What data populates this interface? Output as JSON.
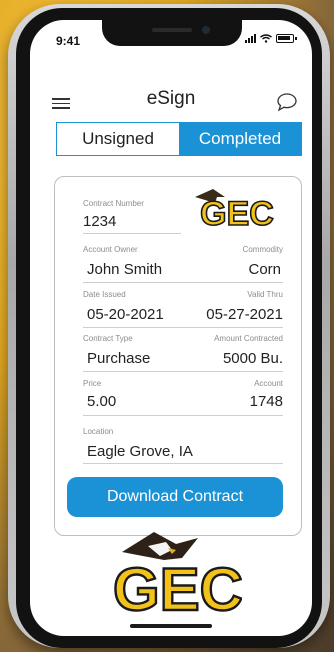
{
  "status_bar": {
    "time": "9:41"
  },
  "header": {
    "title": "eSign"
  },
  "tabs": [
    {
      "label": "Unsigned",
      "active": false
    },
    {
      "label": "Completed",
      "active": true
    }
  ],
  "contract": {
    "contract_number": {
      "label": "Contract Number",
      "value": "1234"
    },
    "account_owner": {
      "label": "Account Owner",
      "value": "John Smith"
    },
    "commodity": {
      "label": "Commodity",
      "value": "Corn"
    },
    "date_issued": {
      "label": "Date Issued",
      "value": "05-20-2021"
    },
    "valid_thru": {
      "label": "Valid Thru",
      "value": "05-27-2021"
    },
    "contract_type": {
      "label": "Contract Type",
      "value": "Purchase"
    },
    "amount_contracted": {
      "label": "Amount Contracted",
      "value": "5000 Bu."
    },
    "price": {
      "label": "Price",
      "value": "5.00"
    },
    "account": {
      "label": "Account",
      "value": "1748"
    },
    "location": {
      "label": "Location",
      "value": "Eagle Grove, IA"
    }
  },
  "download_button": {
    "label": "Download Contract"
  },
  "logo": {
    "text": "GEC"
  },
  "colors": {
    "accent": "#1c92d6",
    "logo_gold": "#f2c21b",
    "logo_outline": "#1a1a1a"
  },
  "icons": {
    "menu": "hamburger-menu-icon",
    "chat": "chat-bubble-icon",
    "signal": "signal-icon",
    "wifi": "wifi-icon",
    "battery": "battery-icon"
  }
}
